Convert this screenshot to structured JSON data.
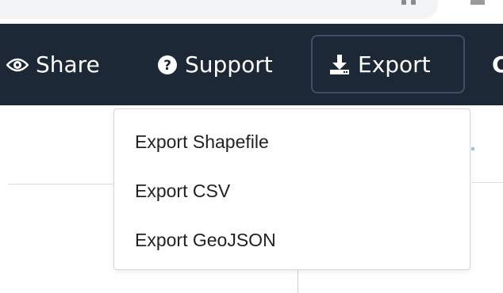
{
  "navbar": {
    "share_label": "Share",
    "support_label": "Support",
    "export_label": "Export",
    "partial_label": "C",
    "icons": {
      "share": "eye-icon",
      "support": "question-circle-icon",
      "export": "download-icon"
    }
  },
  "export_menu": {
    "items": [
      {
        "label": "Export Shapefile"
      },
      {
        "label": "Export CSV"
      },
      {
        "label": "Export GeoJSON"
      }
    ]
  },
  "colors": {
    "navbar_bg": "#1c2836",
    "export_border": "#3c5168",
    "menu_text": "#222222"
  }
}
